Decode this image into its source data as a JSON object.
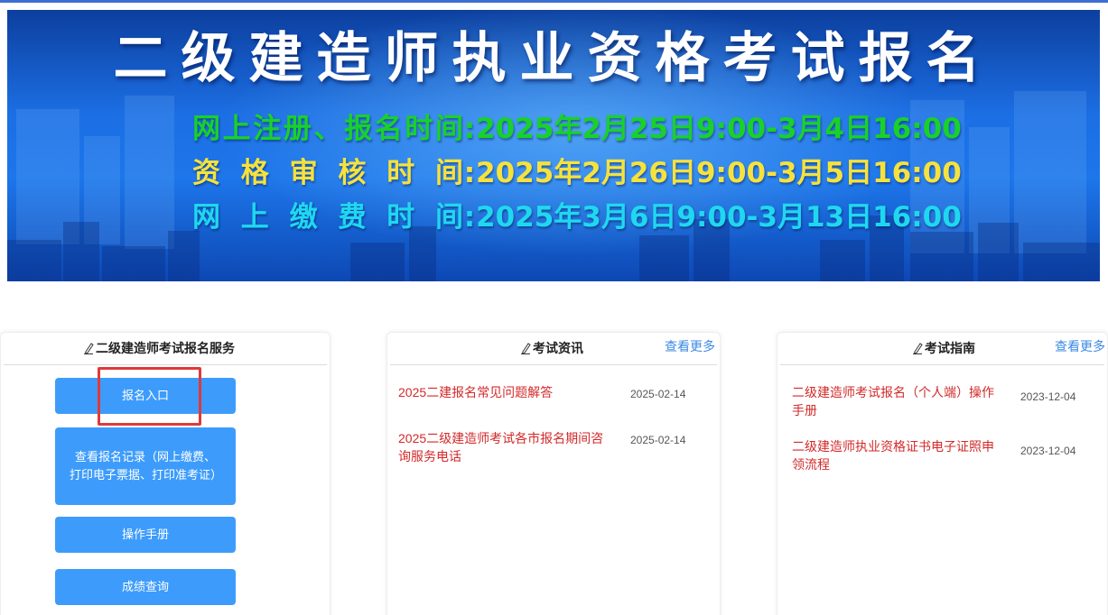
{
  "banner": {
    "title": "二级建造师执业资格考试报名",
    "lines": [
      {
        "label": "网上注册、报名时间",
        "sep": ":",
        "time": "2025年2月25日9:00-3月4日16:00",
        "color": "#19d12a"
      },
      {
        "label": "资格审核时间",
        "sep": ":",
        "time": "2025年2月26日9:00-3月5日16:00",
        "color": "#f6e23c"
      },
      {
        "label": "网上缴费时间",
        "sep": ":",
        "time": "2025年3月6日9:00-3月13日16:00",
        "color": "#1fd8f0"
      }
    ]
  },
  "service": {
    "title": "二级建造师考试报名服务",
    "buttons": [
      {
        "label": "报名入口"
      },
      {
        "label": "查看报名记录（网上缴费、打印电子票据、打印准考证）"
      },
      {
        "label": "操作手册"
      },
      {
        "label": "成绩查询"
      }
    ]
  },
  "news": {
    "title": "考试资讯",
    "more": "查看更多",
    "items": [
      {
        "title": "2025二建报名常见问题解答",
        "date": "2025-02-14"
      },
      {
        "title": "2025二级建造师考试各市报名期间咨询服务电话",
        "date": "2025-02-14"
      }
    ]
  },
  "guide": {
    "title": "考试指南",
    "more": "查看更多",
    "items": [
      {
        "title": "二级建造师考试报名（个人端）操作手册",
        "date": "2023-12-04"
      },
      {
        "title": "二级建造师执业资格证书电子证照申领流程",
        "date": "2023-12-04"
      }
    ]
  },
  "colors": {
    "accent_button": "#3d9cfb",
    "link_red": "#d32a2a",
    "more_blue": "#3b8ae6",
    "highlight_red": "#e0393b"
  },
  "icons": {
    "pen": "pen-icon"
  }
}
